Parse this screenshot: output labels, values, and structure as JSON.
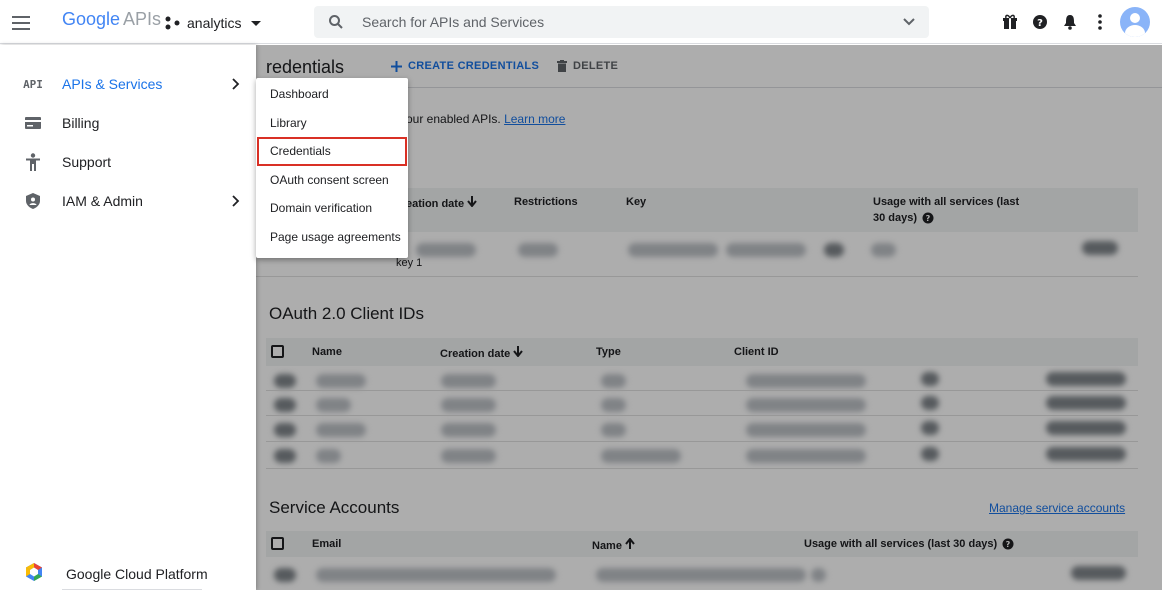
{
  "topbar": {
    "logo_google": "Google",
    "logo_apis": "APIs",
    "project": "analytics",
    "search_placeholder": "Search for APIs and Services"
  },
  "sidebar": {
    "items": [
      {
        "icon": "API",
        "label": "APIs & Services"
      },
      {
        "label": "Billing"
      },
      {
        "label": "Support"
      },
      {
        "label": "IAM & Admin"
      }
    ],
    "footer": "Google Cloud Platform"
  },
  "menu": {
    "items": [
      "Dashboard",
      "Library",
      "Credentials",
      "OAuth consent screen",
      "Domain verification",
      "Page usage agreements"
    ],
    "selected": "Credentials"
  },
  "page": {
    "title": "redentials",
    "create": "CREATE CREDENTIALS",
    "delete": "DELETE",
    "intro": "our enabled APIs.",
    "learn_more": "Learn more"
  },
  "api_keys": {
    "headers": [
      "eation date",
      "Restrictions",
      "Key",
      "Usage with all services (last",
      "30 days)"
    ],
    "row_name": "key 1"
  },
  "oauth": {
    "title": "OAuth 2.0 Client IDs",
    "headers": [
      "Name",
      "Creation date",
      "Type",
      "Client ID"
    ]
  },
  "service": {
    "title": "Service Accounts",
    "manage": "Manage service accounts",
    "headers": [
      "Email",
      "Name",
      "Usage with all services (last 30 days)"
    ]
  },
  "colors": {
    "accent": "#1a73e8",
    "highlight": "#d93025"
  }
}
